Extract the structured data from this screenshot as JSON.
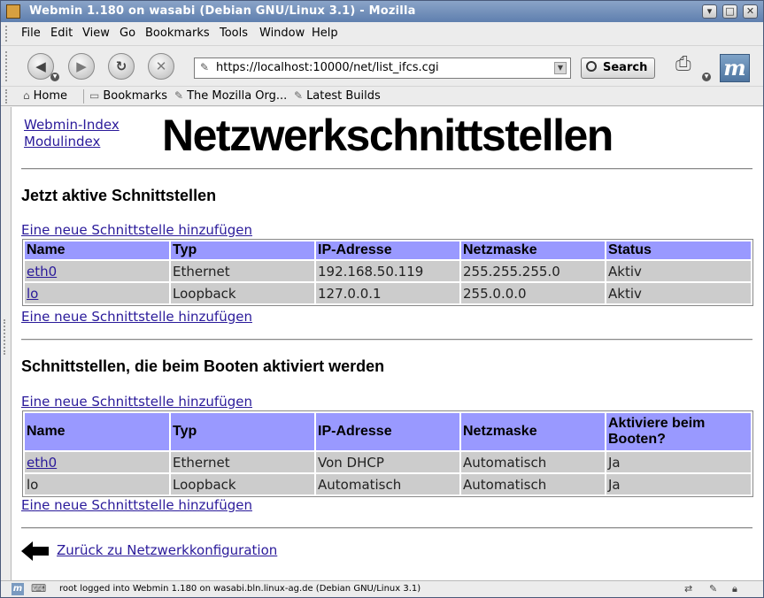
{
  "window": {
    "title": "Webmin 1.180 on wasabi (Debian GNU/Linux 3.1) - Mozilla"
  },
  "menu": [
    "File",
    "Edit",
    "View",
    "Go",
    "Bookmarks",
    "Tools",
    "Window",
    "Help"
  ],
  "nav": {
    "url": "https://localhost:10000/net/list_ifcs.cgi",
    "search_label": "Search"
  },
  "bookmarks": [
    "Home",
    "Bookmarks",
    "The Mozilla Org...",
    "Latest Builds"
  ],
  "page": {
    "top_links": [
      "Webmin-Index",
      "Modulindex"
    ],
    "title": "Netzwerkschnittstellen",
    "active_section": {
      "heading": "Jetzt aktive Schnittstellen",
      "add_link_top": "Eine neue Schnittstelle hinzufügen",
      "add_link_bottom": "Eine neue Schnittstelle hinzufügen",
      "columns": [
        "Name",
        "Typ",
        "IP-Adresse",
        "Netzmaske",
        "Status"
      ],
      "rows": [
        [
          "eth0",
          "Ethernet",
          "192.168.50.119",
          "255.255.255.0",
          "Aktiv"
        ],
        [
          "lo",
          "Loopback",
          "127.0.0.1",
          "255.0.0.0",
          "Aktiv"
        ]
      ]
    },
    "boot_section": {
      "heading": "Schnittstellen, die beim Booten aktiviert werden",
      "add_link_top": "Eine neue Schnittstelle hinzufügen",
      "add_link_bottom": "Eine neue Schnittstelle hinzufügen",
      "columns": [
        "Name",
        "Typ",
        "IP-Adresse",
        "Netzmaske",
        "Aktiviere beim Booten?"
      ],
      "rows": [
        [
          "eth0",
          "Ethernet",
          "Von DHCP",
          "Automatisch",
          "Ja"
        ],
        [
          "lo",
          "Loopback",
          "Automatisch",
          "Automatisch",
          "Ja"
        ]
      ]
    },
    "back_link": "Zurück zu Netzwerkkonfiguration"
  },
  "status": {
    "text": "root logged into Webmin 1.180 on wasabi.bln.linux-ag.de (Debian GNU/Linux 3.1)"
  },
  "colors": {
    "table_header": "#9999ff",
    "table_cell": "#cccccc",
    "link": "#2a1a9a"
  }
}
